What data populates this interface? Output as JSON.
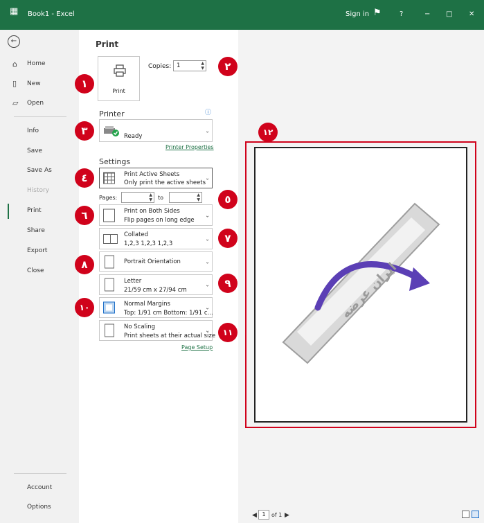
{
  "titlebar": {
    "app_title": "Book1 - Excel",
    "signin": "Sign in",
    "help": "?",
    "minimize": "−",
    "restore": "□",
    "close": "✕"
  },
  "nav": {
    "back_glyph": "←",
    "items": [
      "Home",
      "New",
      "Open",
      "Info",
      "Save",
      "Save As",
      "History",
      "Print",
      "Share",
      "Export",
      "Close",
      "Account",
      "Options"
    ]
  },
  "print": {
    "title": "Print",
    "copies_label": "Copies:",
    "copies_value": "1",
    "print_button": "Print",
    "printer_heading": "Printer",
    "printer_status": "Ready",
    "printer_properties": "Printer Properties",
    "settings_heading": "Settings",
    "pages_label": "Pages:",
    "pages_to": "to",
    "page_setup": "Page Setup",
    "settings": [
      {
        "line1": "Print Active Sheets",
        "line2": "Only print the active sheets"
      },
      {
        "line1": "Print on Both Sides",
        "line2": "Flip pages on long edge"
      },
      {
        "line1": "Collated",
        "line2": "1,2,3    1,2,3    1,2,3"
      },
      {
        "line1": "Portrait Orientation",
        "line2": ""
      },
      {
        "line1": "Letter",
        "line2": "21/59 cm x 27/94 cm"
      },
      {
        "line1": "Normal Margins",
        "line2": "Top: 1/91 cm Bottom: 1/91 c..."
      },
      {
        "line1": "No Scaling",
        "line2": "Print sheets at their actual size"
      }
    ]
  },
  "badges": [
    "١",
    "٢",
    "٣",
    "٤",
    "٥",
    "٦",
    "٧",
    "٨",
    "٩",
    "١٠",
    "١١",
    "١٢"
  ],
  "preview": {
    "page_number": "1",
    "of_pages": "of 1",
    "watermark": "ایران عرضه"
  },
  "colors": {
    "excel_green": "#1e7145",
    "annotation_red": "#d0021b",
    "watermark_purple": "#5b3fb5"
  }
}
